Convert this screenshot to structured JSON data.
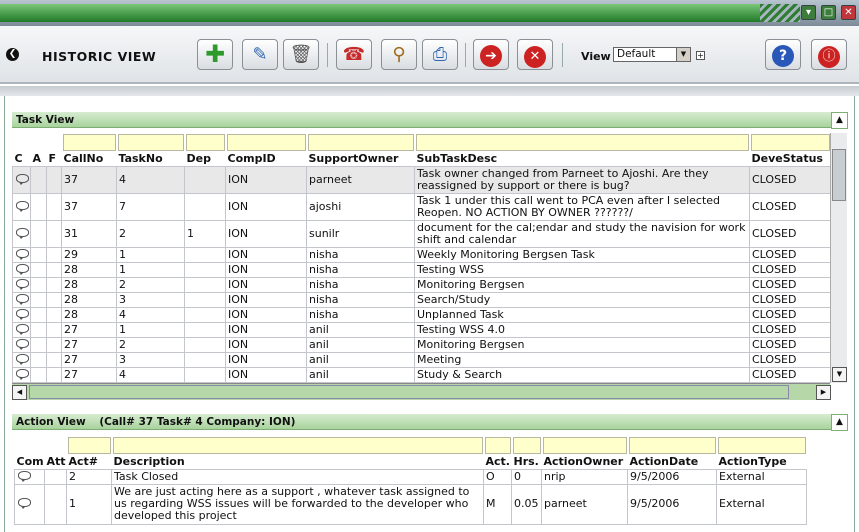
{
  "toolbar": {
    "title": "HISTORIC VIEW",
    "view_label": "View",
    "view_value": "Default",
    "buttons": [
      "add-icon",
      "edit-icon",
      "delete-icon",
      "phone-icon",
      "search-icon",
      "attach-icon",
      "forward-icon",
      "cancel-icon",
      "help-icon",
      "info-icon"
    ]
  },
  "task_view": {
    "title": "Task View",
    "columns": [
      "C",
      "A",
      "F",
      "CallNo",
      "TaskNo",
      "Dep",
      "CompID",
      "SupportOwner",
      "SubTaskDesc",
      "DeveStatus"
    ],
    "rows": [
      {
        "callno": "37",
        "taskno": "4",
        "dep": "",
        "compid": "ION",
        "owner": "parneet",
        "desc": "Task owner changed from Parneet to Ajoshi. Are they reassigned by support or there is bug?",
        "status": "CLOSED"
      },
      {
        "callno": "37",
        "taskno": "7",
        "dep": "",
        "compid": "ION",
        "owner": "ajoshi",
        "desc": "Task 1 under this call went to PCA even after I selected Reopen. NO ACTION BY OWNER ??????/",
        "status": "CLOSED"
      },
      {
        "callno": "31",
        "taskno": "2",
        "dep": "1",
        "compid": "ION",
        "owner": "sunilr",
        "desc": "document for the cal;endar and study the navision for work shift and calendar",
        "status": "CLOSED"
      },
      {
        "callno": "29",
        "taskno": "1",
        "dep": "",
        "compid": "ION",
        "owner": "nisha",
        "desc": "Weekly Monitoring Bergsen Task",
        "status": "CLOSED"
      },
      {
        "callno": "28",
        "taskno": "1",
        "dep": "",
        "compid": "ION",
        "owner": "nisha",
        "desc": "Testing WSS",
        "status": "CLOSED"
      },
      {
        "callno": "28",
        "taskno": "2",
        "dep": "",
        "compid": "ION",
        "owner": "nisha",
        "desc": "Monitoring Bergsen",
        "status": "CLOSED"
      },
      {
        "callno": "28",
        "taskno": "3",
        "dep": "",
        "compid": "ION",
        "owner": "nisha",
        "desc": "Search/Study",
        "status": "CLOSED"
      },
      {
        "callno": "28",
        "taskno": "4",
        "dep": "",
        "compid": "ION",
        "owner": "nisha",
        "desc": "Unplanned Task",
        "status": "CLOSED"
      },
      {
        "callno": "27",
        "taskno": "1",
        "dep": "",
        "compid": "ION",
        "owner": "anil",
        "desc": "Testing WSS 4.0",
        "status": "CLOSED"
      },
      {
        "callno": "27",
        "taskno": "2",
        "dep": "",
        "compid": "ION",
        "owner": "anil",
        "desc": "Monitoring Bergsen",
        "status": "CLOSED"
      },
      {
        "callno": "27",
        "taskno": "3",
        "dep": "",
        "compid": "ION",
        "owner": "anil",
        "desc": "Meeting",
        "status": "CLOSED"
      },
      {
        "callno": "27",
        "taskno": "4",
        "dep": "",
        "compid": "ION",
        "owner": "anil",
        "desc": "Study & Search",
        "status": "CLOSED"
      }
    ]
  },
  "action_view": {
    "title": "Action View",
    "subtitle": "(Call# 37 Task# 4 Company: ION)",
    "columns": [
      "Com",
      "Att",
      "Act#",
      "Description",
      "Act.",
      "Hrs.",
      "ActionOwner",
      "ActionDate",
      "ActionType"
    ],
    "rows": [
      {
        "act": "2",
        "desc": "Task Closed",
        "actcode": "O",
        "hrs": "0",
        "owner": "nrip",
        "date": "9/5/2006",
        "type": "External"
      },
      {
        "act": "1",
        "desc": "We are just acting here as a support , whatever task assigned to us regarding WSS issues will be forwarded to the developer who developed this project",
        "actcode": "M",
        "hrs": "0.05",
        "owner": "parneet",
        "date": "9/5/2006",
        "type": "External"
      }
    ]
  }
}
